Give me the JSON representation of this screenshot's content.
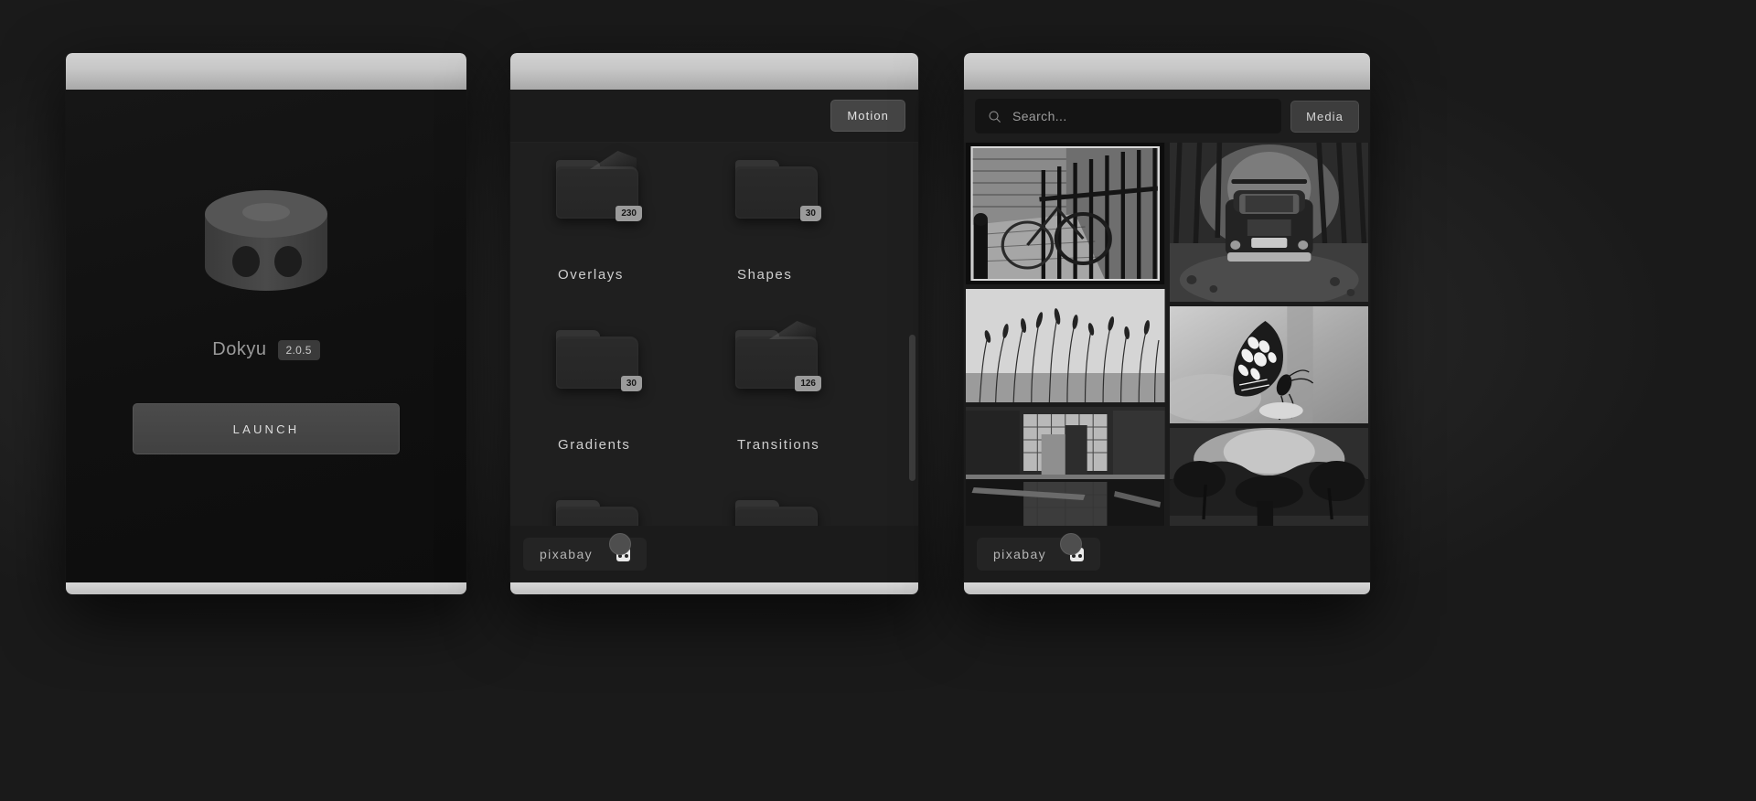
{
  "splash": {
    "app_name": "Dokyu",
    "version": "2.0.5",
    "launch_label": "LAUNCH",
    "logo_icon": "cylinder-logo-icon"
  },
  "folders": {
    "tab_label": "Motion",
    "items": [
      {
        "label": "Overlays",
        "count": "230",
        "peek": true
      },
      {
        "label": "Shapes",
        "count": "30",
        "peek": false
      },
      {
        "label": "Gradients",
        "count": "30",
        "peek": false
      },
      {
        "label": "Transitions",
        "count": "126",
        "peek": true
      }
    ],
    "footer": {
      "brand": "pixabay",
      "icon": "pixabay-icon"
    }
  },
  "media": {
    "search_placeholder": "Search...",
    "search_value": "",
    "search_icon": "search-icon",
    "media_button": "Media",
    "footer": {
      "brand": "pixabay",
      "icon": "pixabay-icon"
    },
    "thumbnails": [
      {
        "name": "bicycle-iron-gate-photo",
        "column": "left",
        "tone": "mid"
      },
      {
        "name": "grass-bright-sky-photo",
        "column": "left",
        "tone": "light"
      },
      {
        "name": "abandoned-flooded-hall-photo",
        "column": "left",
        "tone": "dark"
      },
      {
        "name": "vintage-car-forest-photo",
        "column": "right",
        "tone": "dark"
      },
      {
        "name": "butterfly-macro-photo",
        "column": "right",
        "tone": "light"
      },
      {
        "name": "trees-landscape-photo",
        "column": "right",
        "tone": "mid"
      }
    ]
  },
  "colors": {
    "background": "#1a1a1a",
    "window_body": "#1b1b1b",
    "titlebar": "#c6c6c6",
    "accent_button": "#454545",
    "text_primary": "#d6d6d6",
    "text_muted": "#9a9a9a",
    "badge_bg": "#9b9b9b"
  }
}
